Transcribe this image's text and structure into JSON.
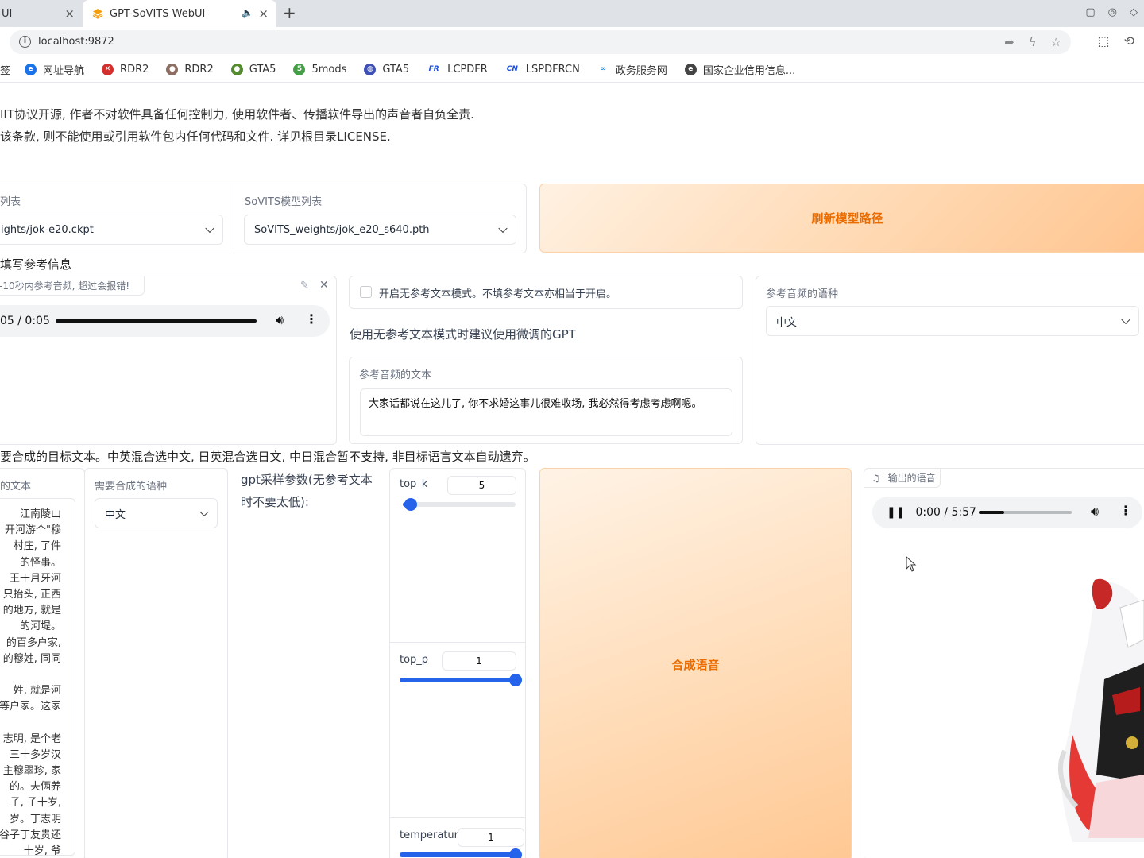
{
  "browser": {
    "inactive_tab_label": "UI",
    "active_tab_title": "GPT-SoVITS WebUI",
    "tab_close": "×",
    "new_tab": "+",
    "url": "localhost:9872",
    "bookmarks": [
      {
        "label": "签",
        "icon": "bookmark-icon",
        "color": "#ffffff"
      },
      {
        "label": "网址导航",
        "icon": "ie-icon",
        "color": "#1a73e8"
      },
      {
        "label": "RDR2",
        "icon": "rdr2-icon",
        "color": "#d32f2f"
      },
      {
        "label": "RDR2",
        "icon": "rdr2-emblem-icon",
        "color": "#8d6e63"
      },
      {
        "label": "GTA5",
        "icon": "gta5-icon",
        "color": "#558b2f"
      },
      {
        "label": "5mods",
        "icon": "5mods-icon",
        "color": "#43a047"
      },
      {
        "label": "GTA5",
        "icon": "gta5-globe-icon",
        "color": "#3f51b5"
      },
      {
        "label": "LCPDFR",
        "icon": "fr-icon",
        "color": "#1e4fd8"
      },
      {
        "label": "LSPDFRCN",
        "icon": "cn-icon",
        "color": "#1e4fd8"
      },
      {
        "label": "政务服务网",
        "icon": "gov-icon",
        "color": "#1e88e5"
      },
      {
        "label": "国家企业信用信息...",
        "icon": "credit-icon",
        "color": "#444444"
      }
    ]
  },
  "notice": {
    "line1": "IIT协议开源, 作者不对软件具备任何控制力, 使用软件者、传播软件导出的声音者自负全责.",
    "line2": "该条款, 则不能使用或引用软件包内任何代码和文件. 详见根目录LICENSE."
  },
  "models": {
    "gpt_label": "列表",
    "gpt_value": "ights/jok-e20.ckpt",
    "sovits_label": "SoVITS模型列表",
    "sovits_value": "SoVITS_weights/jok_e20_s640.pth",
    "refresh_button": "刷新模型路径"
  },
  "reference": {
    "section_title": "填写参考信息",
    "audio_hint": "-10秒内参考音频, 超过会报错!",
    "audio_time": "05 / 0:05",
    "no_ref_checkbox_label": "开启无参考文本模式。不填参考文本亦相当于开启。",
    "no_ref_checked": false,
    "no_ref_tip": "使用无参考文本模式时建议使用微调的GPT",
    "ref_text_label": "参考音频的文本",
    "ref_text_value": "大家话都说在这儿了, 你不求婚这事儿很难收场, 我必然得考虑考虑啊嗯。",
    "ref_lang_label": "参考音频的语种",
    "ref_lang_value": "中文"
  },
  "synthesis": {
    "section_title": "要合成的目标文本。中英混合选中文, 日英混合选日文, 中日混合暂不支持, 非目标语言文本自动遗弃。",
    "target_text_label": "的文本",
    "target_text_lines": [
      "江南陵山",
      "开河游个\"穆",
      "村庄, 了件",
      "的怪事。",
      "王于月牙河",
      "只抬头, 正西",
      "的地方, 就是",
      "的河堤。",
      "的百多户家,",
      "的穆姓, 同同",
      "",
      "姓, 就是河",
      "等户家。这家",
      "",
      "志明, 是个老",
      "三十多岁汉",
      "主穆翠珍, 家",
      "的。夫俩养",
      "子, 子十岁,",
      "岁。丁志明",
      "谷子丁友贵还",
      "十岁, 爷"
    ],
    "target_lang_label": "需要合成的语种",
    "target_lang_value": "中文",
    "gpt_params_label": "gpt采样参数(无参考文本时不要太低):",
    "top_k_label": "top_k",
    "top_k_value": "5",
    "top_k_fraction": 0.07,
    "top_p_label": "top_p",
    "top_p_value": "1",
    "top_p_fraction": 1.0,
    "temperature_label": "temperature",
    "temperature_value": "1",
    "temperature_fraction": 1.0,
    "synth_button": "合成语音",
    "output_label": "输出的语音",
    "output_time": "0:00 / 5:57",
    "output_progress": 0.27
  },
  "colors": {
    "accent": "#2563eb",
    "orange_text": "#ea6c00"
  }
}
